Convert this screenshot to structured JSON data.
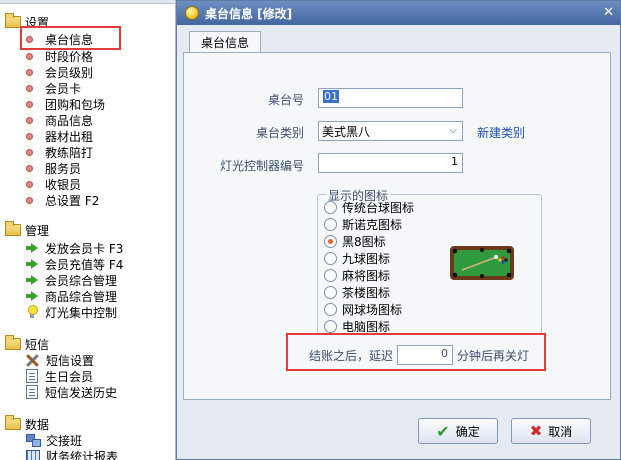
{
  "sidebar": {
    "groups": [
      {
        "label": "设置",
        "items": [
          "桌台信息",
          "时段价格",
          "会员级别",
          "会员卡",
          "团购和包场",
          "商品信息",
          "器材出租",
          "教练陪打",
          "服务员",
          "收银员",
          "总设置  F2"
        ]
      },
      {
        "label": "管理",
        "items": [
          "发放会员卡  F3",
          "会员充值等  F4",
          "会员综合管理",
          "商品综合管理",
          "灯光集中控制"
        ]
      },
      {
        "label": "短信",
        "items": [
          "短信设置",
          "生日会员",
          "短信发送历史"
        ]
      },
      {
        "label": "数据",
        "items": [
          "交接班",
          "财务统计报表"
        ]
      }
    ]
  },
  "dialog": {
    "title": "桌台信息 [修改]",
    "close_glyph": "✕",
    "tab": "桌台信息",
    "fields": {
      "table_no_label": "桌台号",
      "table_no_value": "01",
      "table_type_label": "桌台类别",
      "table_type_value": "美式黑八",
      "new_type_link": "新建类别",
      "light_controller_label": "灯光控制器编号",
      "light_controller_value": "1"
    },
    "icon_group": {
      "title": "显示的图标",
      "options": [
        "传统台球图标",
        "斯诺克图标",
        "黑8图标",
        "九球图标",
        "麻将图标",
        "茶楼图标",
        "网球场图标",
        "电脑图标"
      ],
      "selected": "黑8图标"
    },
    "delay": {
      "prefix": "结账之后，延迟",
      "value": "0",
      "suffix": "分钟后再关灯"
    },
    "buttons": {
      "ok": "确定",
      "cancel": "取消"
    }
  },
  "colors": {
    "titlebar": "#4d71a9",
    "highlight": "#e23b3b",
    "link": "#1f4fb5",
    "table_felt": "#2f9a3e"
  }
}
